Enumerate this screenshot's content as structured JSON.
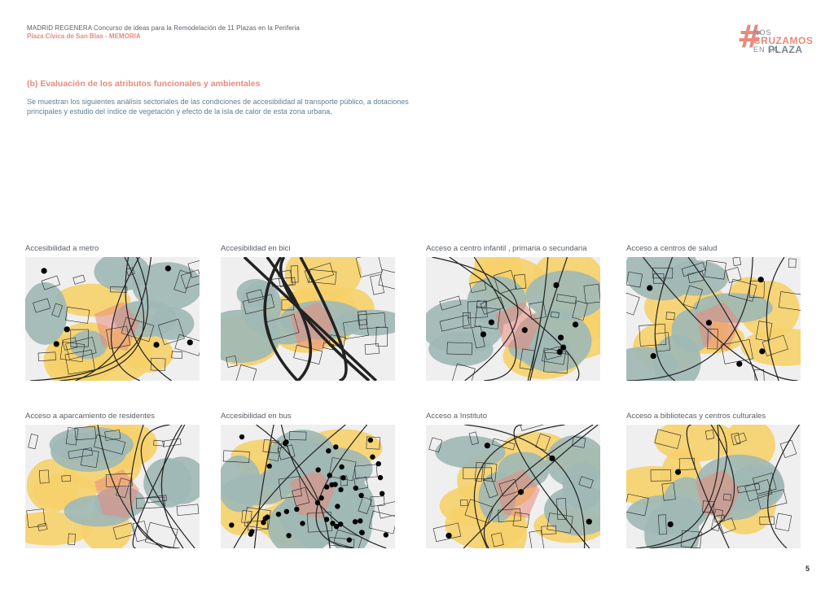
{
  "header": {
    "line1": "MADRID REGENERA Concurso de ideas para la Remodelación de 11 Plazas en la Periferia",
    "line2": "Plaza Cívica de San Blas - MEMORIA"
  },
  "logo": {
    "w1": "NOS",
    "w2": "CRUZAMOS",
    "w3": "EN LA",
    "w4": "PLAZA",
    "mark": "#"
  },
  "section": {
    "title": "(b) Evaluación de los atributos funcionales y ambientales",
    "text": "Se muestran los siguientes análisis sectoriales de las condiciones de accesibilidad al transporte público, a dotaciones principales y estudio del índice de vegetación y efecto de la isla de calor de esta zona urbana."
  },
  "maps": [
    {
      "label": "Accesibilidad a metro"
    },
    {
      "label": "Accesibilidad en bici"
    },
    {
      "label": "Acceso a centro infantil , primaria o secundaria"
    },
    {
      "label": "Acceso a centros de salud"
    },
    {
      "label": "Acceso a aparcamiento de residentes"
    },
    {
      "label": "Accesibilidad en bus"
    },
    {
      "label": "Acceso a Instituto"
    },
    {
      "label": "Acceso a bibliotecas y centros culturales"
    }
  ],
  "colors": {
    "teal": "#9fb9b5",
    "yellow": "#f6d06a",
    "salmon": "#e88a7c",
    "dark": "#222222"
  },
  "page_number": "5"
}
